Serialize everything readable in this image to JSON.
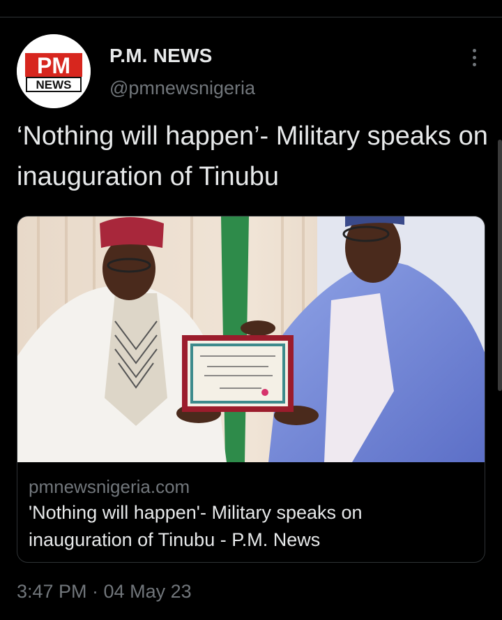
{
  "tweet": {
    "author": {
      "name": "P.M. NEWS",
      "handle": "@pmnewsnigeria",
      "avatar_logo_text_top": "PM",
      "avatar_logo_text_bottom": "NEWS"
    },
    "text": "‘Nothing will happen’- Military speaks on inauguration of Tinubu",
    "more_icon": "more-vertical-icon",
    "link_card": {
      "domain": "pmnewsnigeria.com",
      "title": "'Nothing will happen'- Military speaks on inauguration of Tinubu - P.M. News"
    },
    "timestamp": "3:47 PM · 04 May 23"
  },
  "colors": {
    "background": "#000000",
    "text_primary": "#e7e9ea",
    "text_secondary": "#71767b",
    "border": "#2f3336",
    "logo_red": "#d7261e"
  }
}
